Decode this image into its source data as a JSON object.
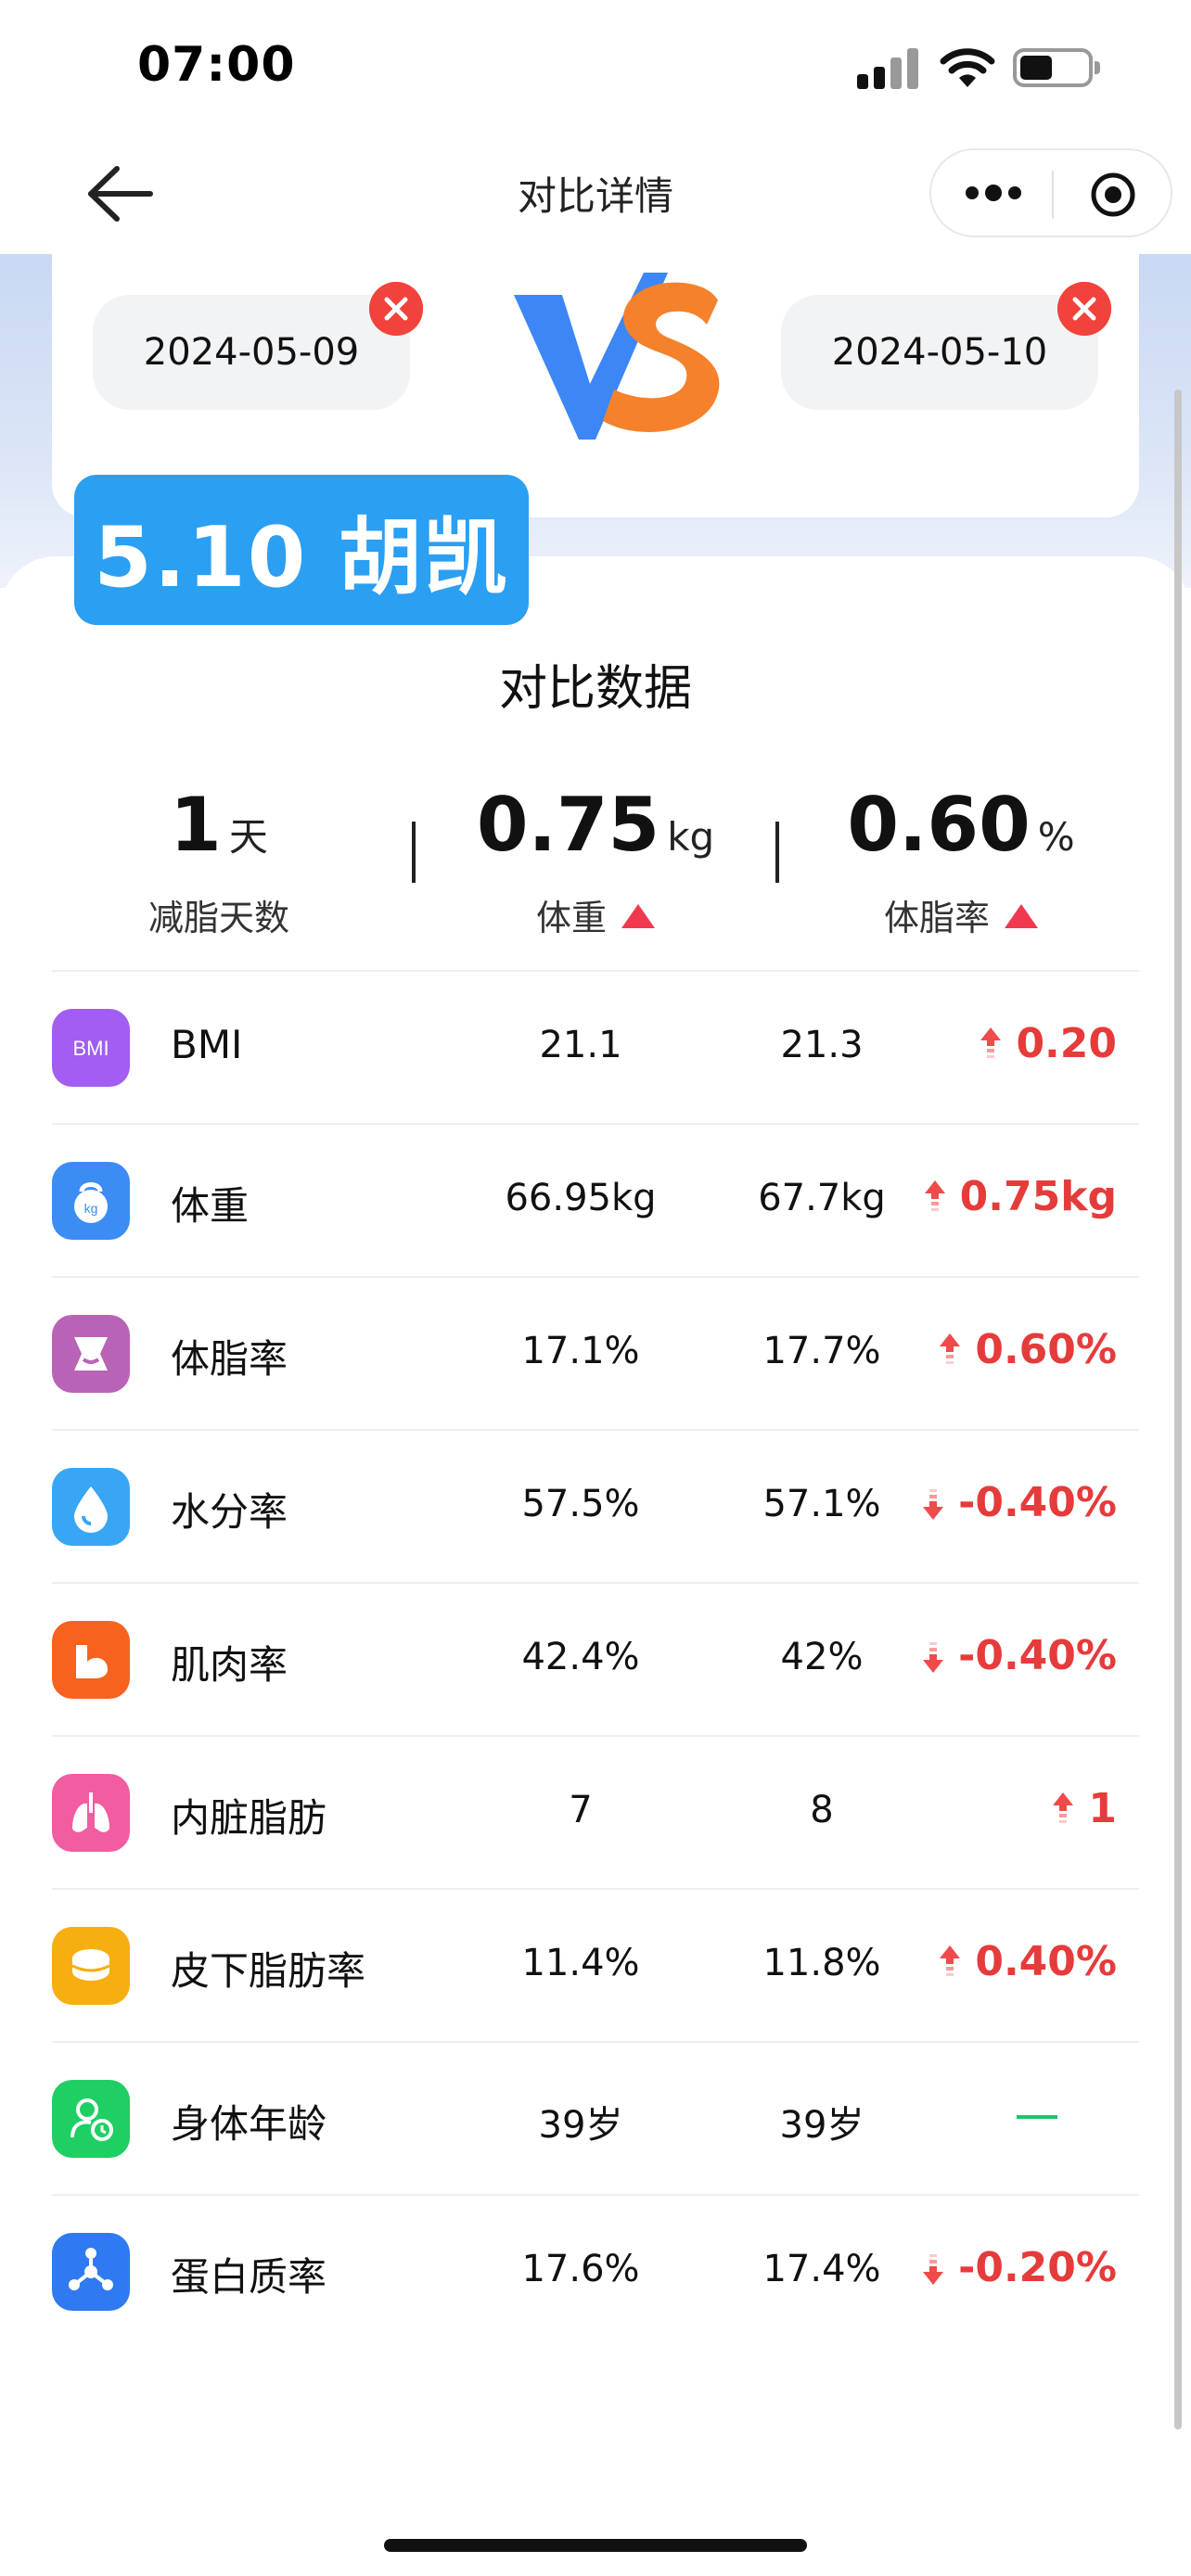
{
  "status_bar": {
    "time": "07:00"
  },
  "nav": {
    "title": "对比详情"
  },
  "compare": {
    "left_date": "2024-05-09",
    "right_date": "2024-05-10",
    "vs_text": "VS"
  },
  "tag": "5.10 胡凯",
  "section_title": "对比数据",
  "summary": [
    {
      "value": "1",
      "unit": "天",
      "label": "减脂天数",
      "trend": ""
    },
    {
      "value": "0.75",
      "unit": "kg",
      "label": "体重",
      "trend": "up"
    },
    {
      "value": "0.60",
      "unit": "%",
      "label": "体脂率",
      "trend": "up"
    }
  ],
  "rows": [
    {
      "name": "BMI",
      "v1": "21.1",
      "v2": "21.3",
      "diff": "0.20",
      "trend": "up",
      "icon": "bmi-icon",
      "color": "#a25df2"
    },
    {
      "name": "体重",
      "v1": "66.95kg",
      "v2": "67.7kg",
      "diff": "0.75kg",
      "trend": "up",
      "icon": "kettlebell-icon",
      "color": "#3b8df3"
    },
    {
      "name": "体脂率",
      "v1": "17.1%",
      "v2": "17.7%",
      "diff": "0.60%",
      "trend": "up",
      "icon": "body-fat-icon",
      "color": "#b963b7"
    },
    {
      "name": "水分率",
      "v1": "57.5%",
      "v2": "57.1%",
      "diff": "-0.40%",
      "trend": "down",
      "icon": "water-drop-icon",
      "color": "#38a6f4"
    },
    {
      "name": "肌肉率",
      "v1": "42.4%",
      "v2": "42%",
      "diff": "-0.40%",
      "trend": "down",
      "icon": "muscle-icon",
      "color": "#f7621f"
    },
    {
      "name": "内脏脂肪",
      "v1": "7",
      "v2": "8",
      "diff": "1",
      "trend": "up",
      "icon": "lungs-icon",
      "color": "#f25ca0"
    },
    {
      "name": "皮下脂肪率",
      "v1": "11.4%",
      "v2": "11.8%",
      "diff": "0.40%",
      "trend": "up",
      "icon": "fat-layers-icon",
      "color": "#f7ae10"
    },
    {
      "name": "身体年龄",
      "v1": "39岁",
      "v2": "39岁",
      "diff": "",
      "trend": "flat",
      "icon": "body-age-icon",
      "color": "#1fcf63"
    },
    {
      "name": "蛋白质率",
      "v1": "17.6%",
      "v2": "17.4%",
      "diff": "-0.20%",
      "trend": "down",
      "icon": "molecule-icon",
      "color": "#2f7af0"
    }
  ],
  "colors": {
    "accent": "#2b9ff2",
    "negative": "#e63b3b",
    "neutral": "#22c36b"
  }
}
